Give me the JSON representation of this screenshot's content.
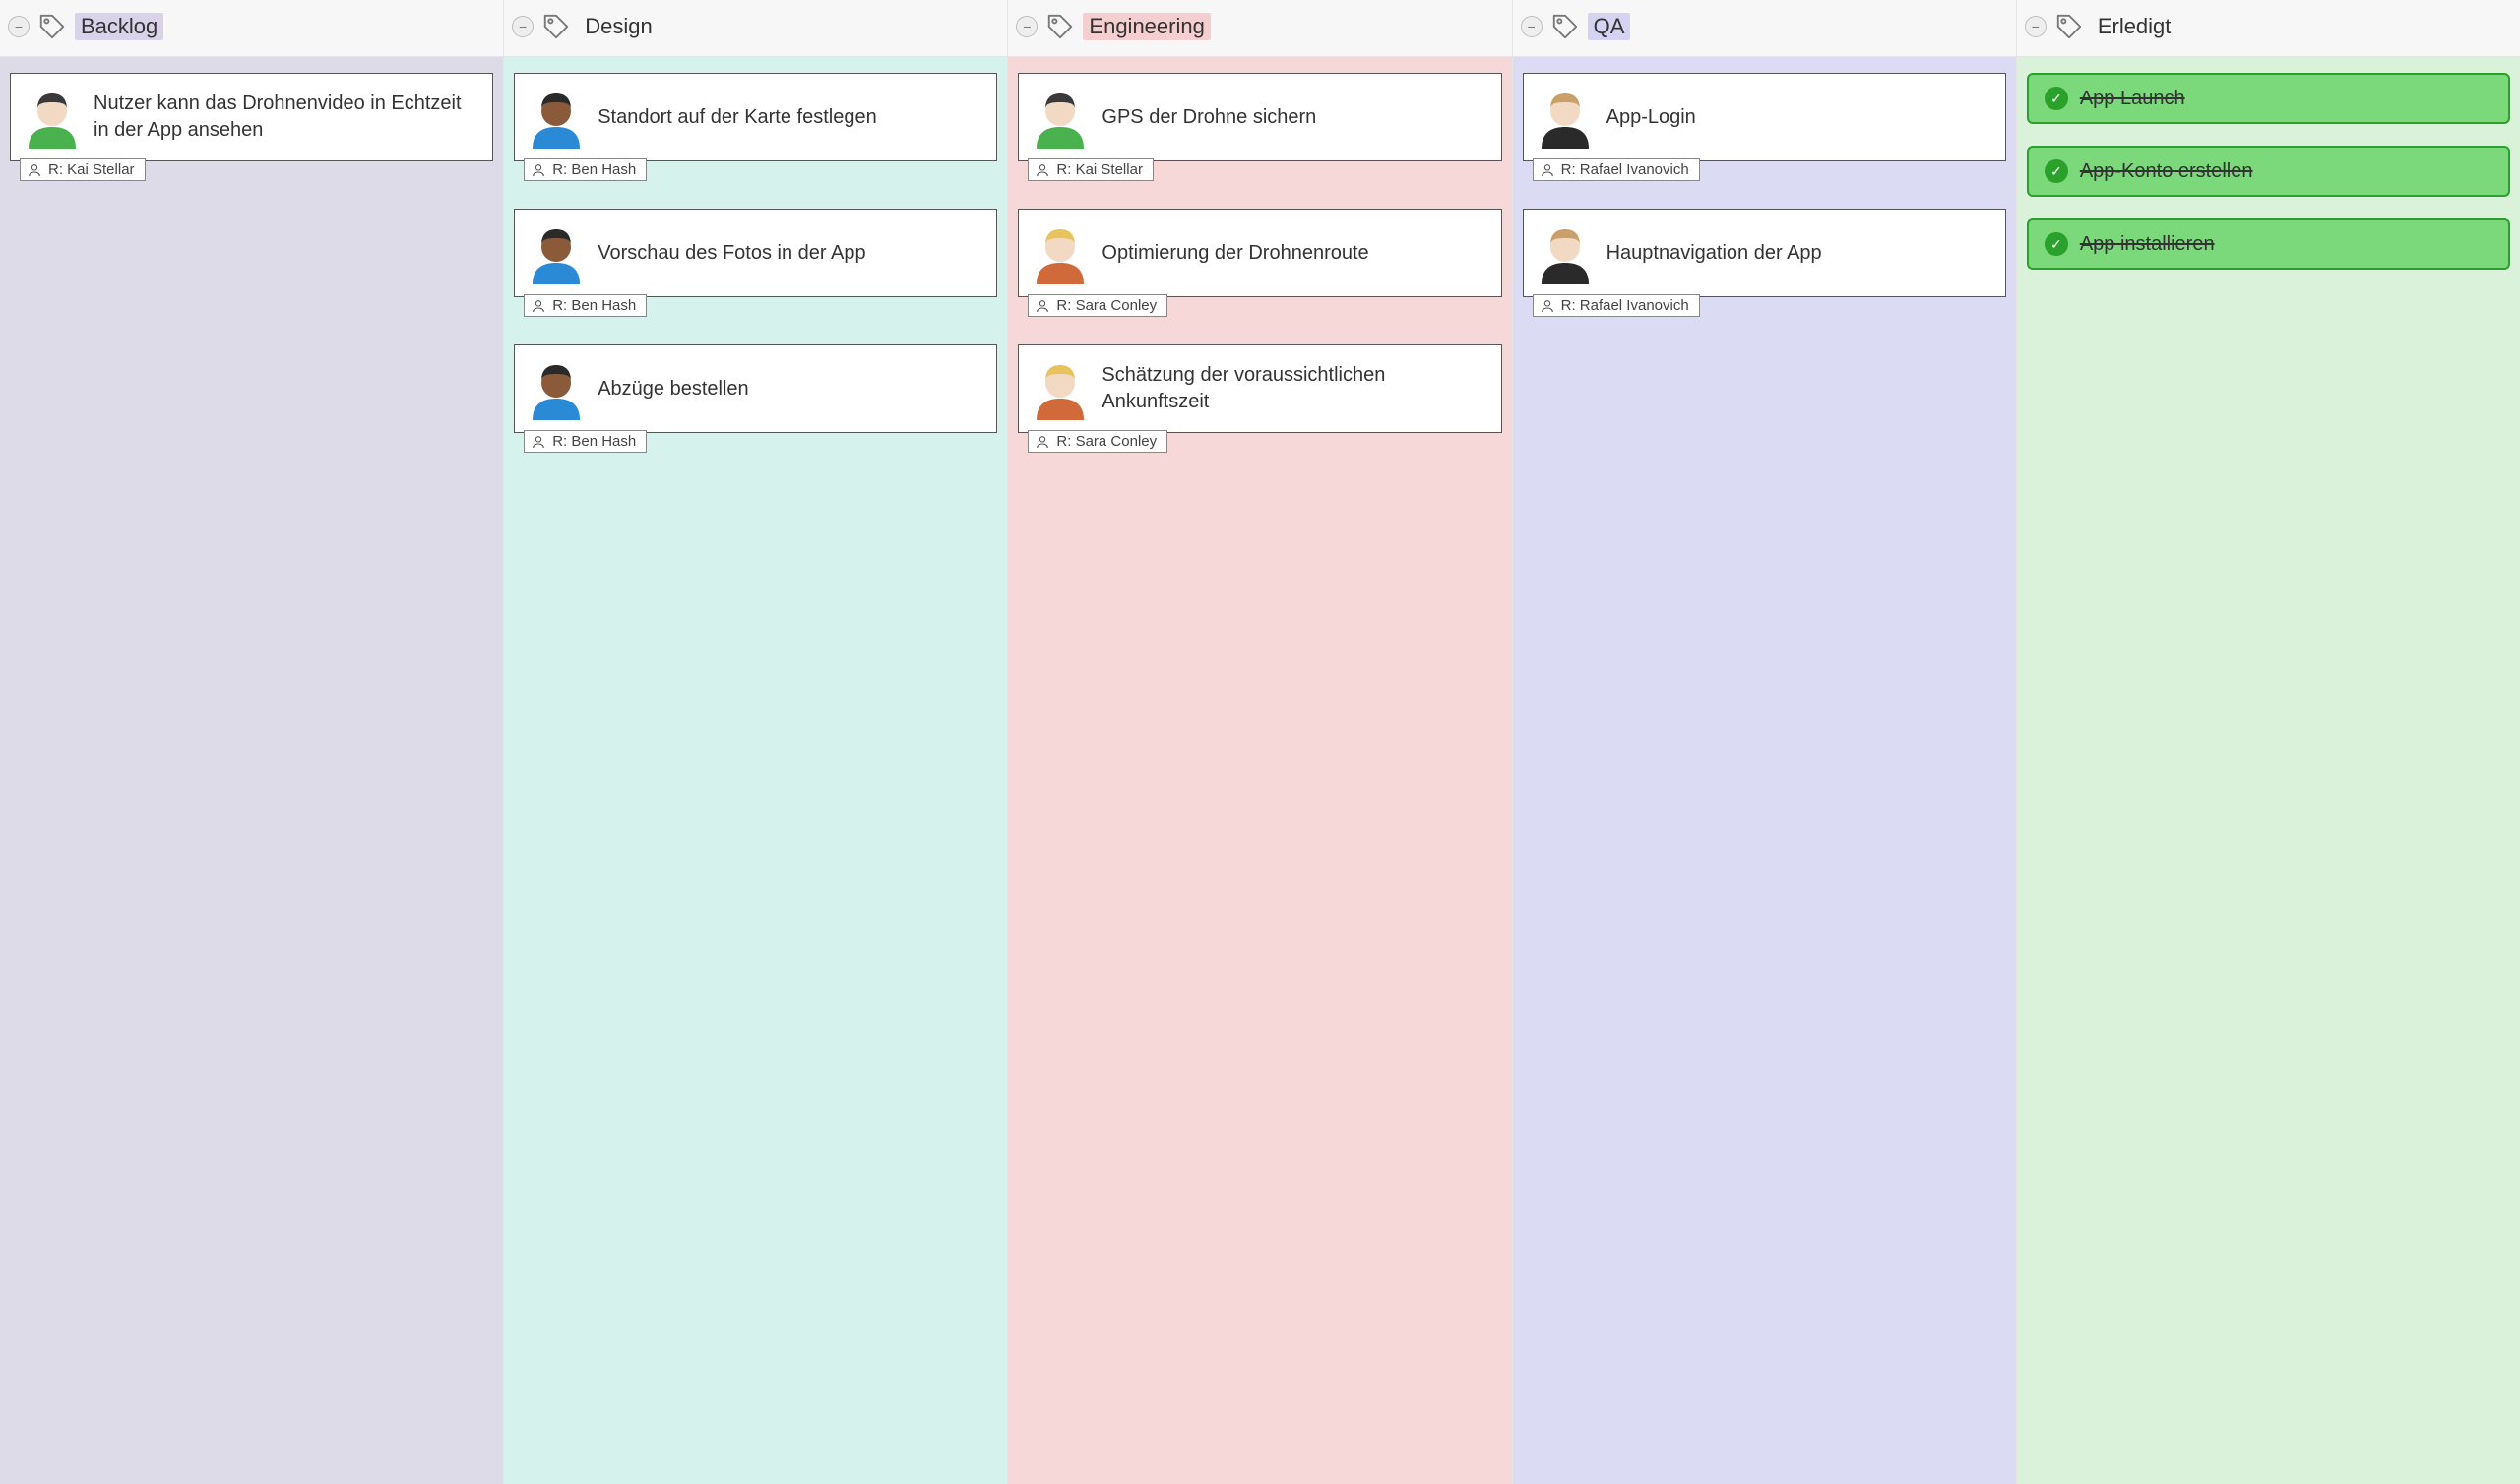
{
  "columns": [
    {
      "id": "backlog",
      "title": "Backlog",
      "title_bg": "#d8d3e8",
      "body_class": "bg-backlog",
      "cards": [
        {
          "title": "Nutzer kann das Drohnenvideo in Echtzeit in der App ansehen",
          "responsible": "R: Kai Stellar",
          "avatar": "kai"
        }
      ],
      "done_items": []
    },
    {
      "id": "design",
      "title": "Design",
      "title_bg": "transparent",
      "body_class": "bg-design",
      "cards": [
        {
          "title": "Standort auf der Karte festlegen",
          "responsible": "R: Ben Hash",
          "avatar": "ben"
        },
        {
          "title": "Vorschau des Fotos in der App",
          "responsible": "R: Ben Hash",
          "avatar": "ben"
        },
        {
          "title": "Abzüge bestellen",
          "responsible": "R: Ben Hash",
          "avatar": "ben"
        }
      ],
      "done_items": []
    },
    {
      "id": "engineering",
      "title": "Engineering",
      "title_bg": "#f5cfcf",
      "body_class": "bg-eng",
      "cards": [
        {
          "title": "GPS der Drohne sichern",
          "responsible": "R: Kai Stellar",
          "avatar": "kai"
        },
        {
          "title": "Optimierung der Drohnenroute",
          "responsible": "R: Sara Conley",
          "avatar": "sara"
        },
        {
          "title": "Schätzung der voraussichtlichen Ankunftszeit",
          "responsible": "R: Sara Conley",
          "avatar": "sara"
        }
      ],
      "done_items": []
    },
    {
      "id": "qa",
      "title": "QA",
      "title_bg": "#d4d4f2",
      "body_class": "bg-qa",
      "cards": [
        {
          "title": "App-Login",
          "responsible": "R: Rafael Ivanovich",
          "avatar": "rafael"
        },
        {
          "title": "Hauptnavigation der App",
          "responsible": "R: Rafael Ivanovich",
          "avatar": "rafael"
        }
      ],
      "done_items": []
    },
    {
      "id": "done",
      "title": "Erledigt",
      "title_bg": "transparent",
      "body_class": "bg-done",
      "cards": [],
      "done_items": [
        {
          "label": "App Launch"
        },
        {
          "label": "App-Konto erstellen"
        },
        {
          "label": "App installieren"
        }
      ]
    }
  ],
  "avatars": {
    "kai": {
      "skin": "#f2d9c4",
      "hair": "#3a3a3a",
      "shirt": "#49b24f"
    },
    "ben": {
      "skin": "#8a5a3a",
      "hair": "#2a2a2a",
      "shirt": "#2a8ad6"
    },
    "sara": {
      "skin": "#f2d9c4",
      "hair": "#e8c25a",
      "shirt": "#d06a3a"
    },
    "rafael": {
      "skin": "#f2d9c4",
      "hair": "#c9a06a",
      "shirt": "#2a2a2a"
    }
  }
}
